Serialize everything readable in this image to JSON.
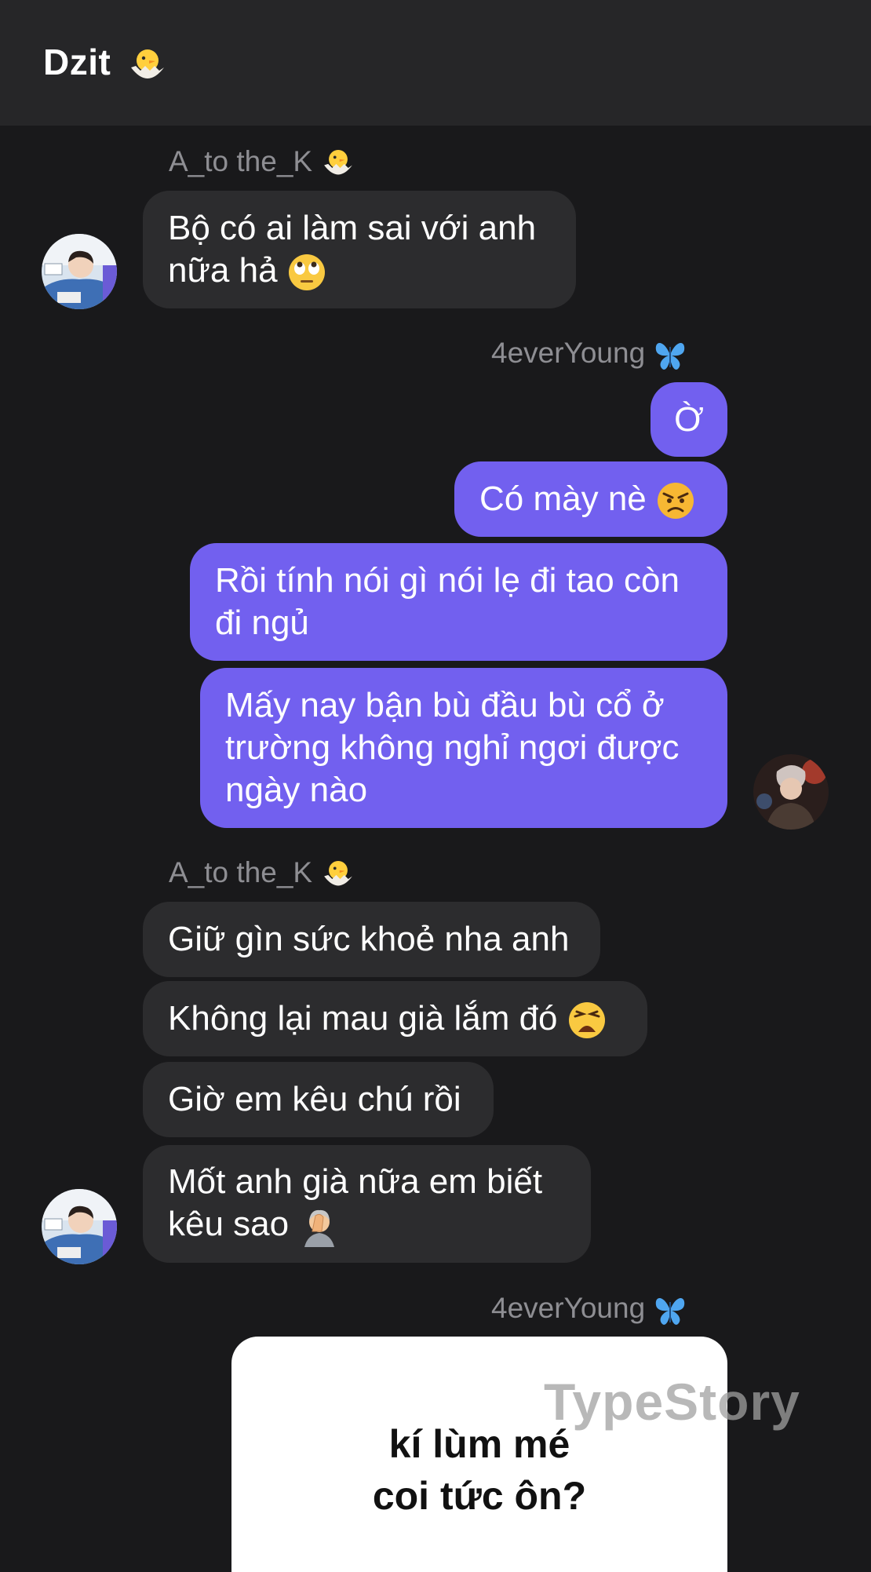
{
  "chat": {
    "title": "Dzit",
    "title_emoji": "hatching-chick"
  },
  "groups": [
    {
      "sender": "A_to the_K",
      "sender_emoji": "hatching-chick",
      "messages": [
        {
          "text": "Bộ có ai làm sai với anh nữa hả",
          "emoji": "face-with-rolling-eyes"
        }
      ]
    },
    {
      "sender": "4everYoung",
      "sender_emoji": "butterfly",
      "messages": [
        {
          "text": "Ờ"
        },
        {
          "text": "Có mày nè",
          "emoji": "angry-face"
        },
        {
          "text": "Rồi tính nói gì nói lẹ đi tao còn đi ngủ"
        },
        {
          "text": "Mấy nay bận bù đầu bù cổ ở trường không nghỉ ngơi được ngày nào"
        }
      ]
    },
    {
      "sender": "A_to the_K",
      "sender_emoji": "hatching-chick",
      "messages": [
        {
          "text": "Giữ gìn sức khoẻ nha anh"
        },
        {
          "text": "Không lại mau già lắm đó",
          "emoji": "weary-face"
        },
        {
          "text": "Giờ em kêu chú rồi"
        },
        {
          "text": "Mốt anh già nữa em biết kêu sao",
          "emoji": "person-facepalming"
        }
      ]
    },
    {
      "sender": "4everYoung",
      "sender_emoji": "butterfly",
      "sticker": {
        "lines": [
          "kí lùm mé",
          "coi tức ôn?"
        ],
        "watermark": "TypeStory"
      }
    }
  ]
}
